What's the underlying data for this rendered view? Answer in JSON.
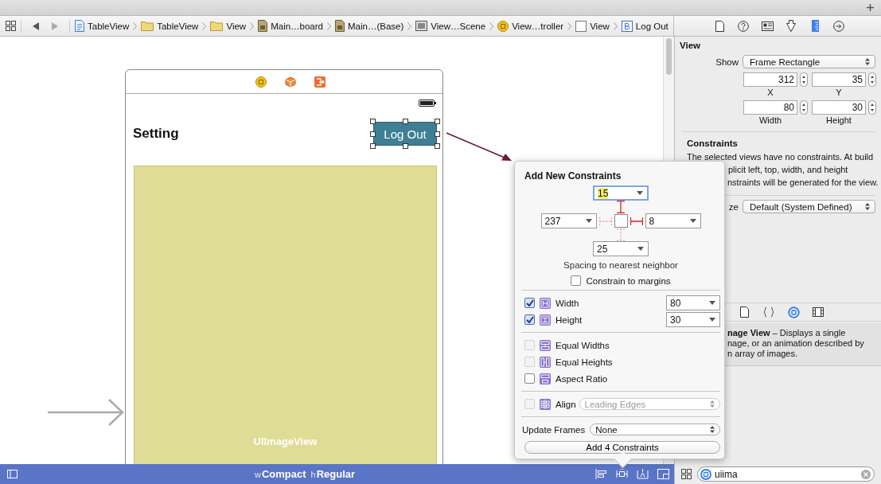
{
  "breadcrumbs": [
    {
      "label": "TableView"
    },
    {
      "label": "TableView"
    },
    {
      "label": "View"
    },
    {
      "label": "Main…board"
    },
    {
      "label": "Main…(Base)"
    },
    {
      "label": "View…Scene"
    },
    {
      "label": "View…troller"
    },
    {
      "label": "View"
    },
    {
      "label": "Log Out"
    }
  ],
  "canvas": {
    "title": "Setting",
    "button": {
      "label": "Log Out",
      "selected": true
    },
    "image_view": {
      "label": "UIImageView"
    }
  },
  "inspector": {
    "tabs": [
      {
        "kind": "file",
        "selected": false
      },
      {
        "kind": "help",
        "selected": false
      },
      {
        "kind": "identity",
        "selected": false
      },
      {
        "kind": "attributes",
        "selected": false
      },
      {
        "kind": "size",
        "selected": true
      },
      {
        "kind": "connections",
        "selected": false
      }
    ],
    "section": "View",
    "show": {
      "label": "Show",
      "value": "Frame Rectangle"
    },
    "frame": [
      {
        "label": "X",
        "value": "312"
      },
      {
        "label": "Y",
        "value": "35"
      },
      {
        "label": "Width",
        "value": "80"
      },
      {
        "label": "Height",
        "value": "30"
      }
    ],
    "constraints_title": "Constraints",
    "constraints_lines": [
      "The selected views have no constraints. At build",
      "plicit left, top, width, and height",
      "nstraints will be generated for the view."
    ],
    "intrinsic": {
      "label": "ze",
      "value": "Default (System Defined)"
    },
    "library_tabs": [
      {
        "kind": "file",
        "selected": false
      },
      {
        "kind": "braces",
        "selected": false
      },
      {
        "kind": "object",
        "selected": true
      },
      {
        "kind": "media",
        "selected": false
      }
    ],
    "library_lines": [
      "**nage View** – Displays a single",
      "nage, or an animation described by",
      "n array of images."
    ]
  },
  "popover": {
    "title": "Add New Constraints",
    "spacing": [
      {
        "value": "15",
        "active": true,
        "focused": true
      },
      {
        "value": "237",
        "active": false,
        "focused": false
      },
      {
        "value": "8",
        "active": true,
        "focused": false
      },
      {
        "value": "25",
        "active": false,
        "focused": false
      }
    ],
    "spacing_caption": "Spacing to nearest neighbor",
    "margins": {
      "label": "Constrain to margins",
      "checked": false
    },
    "size_rows": [
      {
        "label": "Width",
        "checked": true,
        "value": "80"
      },
      {
        "label": "Height",
        "checked": true,
        "value": "30"
      }
    ],
    "equal_rows": [
      {
        "label": "Equal Widths",
        "checked": false,
        "disabled": true
      },
      {
        "label": "Equal Heights",
        "checked": false,
        "disabled": true
      },
      {
        "label": "Aspect Ratio",
        "checked": false,
        "disabled": false
      }
    ],
    "align": {
      "label": "Align",
      "checked": false,
      "disabled": true,
      "value": "Leading Edges"
    },
    "update_frames": {
      "label": "Update Frames",
      "value": "None"
    },
    "add_button": "Add 4 Constraints"
  },
  "bottom_bar": {
    "size_class": [
      {
        "prefix": "w",
        "value": "Compact"
      },
      {
        "prefix": "h",
        "value": "Regular"
      }
    ]
  },
  "filter": {
    "value": "uiima"
  }
}
